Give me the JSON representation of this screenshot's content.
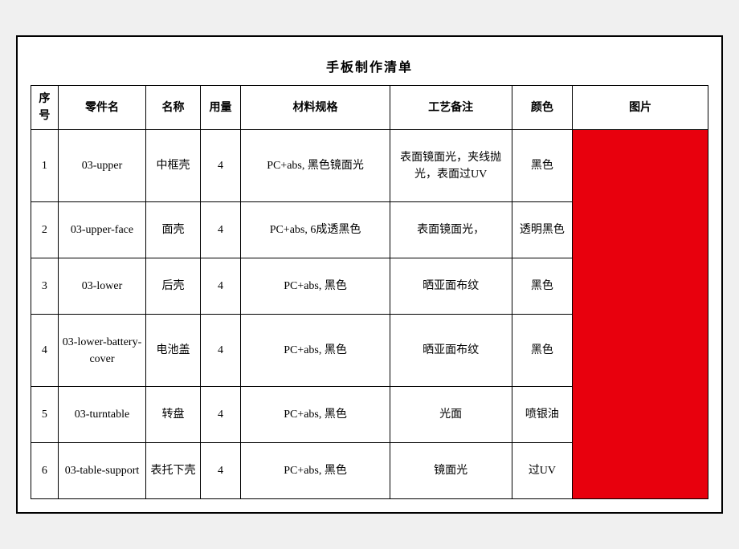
{
  "title": "手板制作清单",
  "headers": {
    "seq": "序号",
    "part_no": "零件名",
    "name": "名称",
    "qty": "用量",
    "spec": "材料规格",
    "process": "工艺备注",
    "color": "颜色",
    "image": "图片"
  },
  "rows": [
    {
      "seq": "1",
      "part_no": "03-upper",
      "name": "中框壳",
      "qty": "4",
      "spec": "PC+abs, 黑色镜面光",
      "process": "表面镜面光，夹线抛光，表面过UV",
      "color": "黑色"
    },
    {
      "seq": "2",
      "part_no": "03-upper-face",
      "name": "面壳",
      "qty": "4",
      "spec": "PC+abs, 6成透黑色",
      "process": "表面镜面光，",
      "color": "透明黑色"
    },
    {
      "seq": "3",
      "part_no": "03-lower",
      "name": "后壳",
      "qty": "4",
      "spec": "PC+abs, 黑色",
      "process": "晒亚面布纹",
      "color": "黑色"
    },
    {
      "seq": "4",
      "part_no": "03-lower-battery-cover",
      "name": "电池盖",
      "qty": "4",
      "spec": "PC+abs, 黑色",
      "process": "晒亚面布纹",
      "color": "黑色"
    },
    {
      "seq": "5",
      "part_no": "03-turntable",
      "name": "转盘",
      "qty": "4",
      "spec": "PC+abs, 黑色",
      "process": "光面",
      "color": "喷银油"
    },
    {
      "seq": "6",
      "part_no": "03-table-support",
      "name": "表托下壳",
      "qty": "4",
      "spec": "PC+abs, 黑色",
      "process": "镜面光",
      "color": "过UV"
    }
  ]
}
